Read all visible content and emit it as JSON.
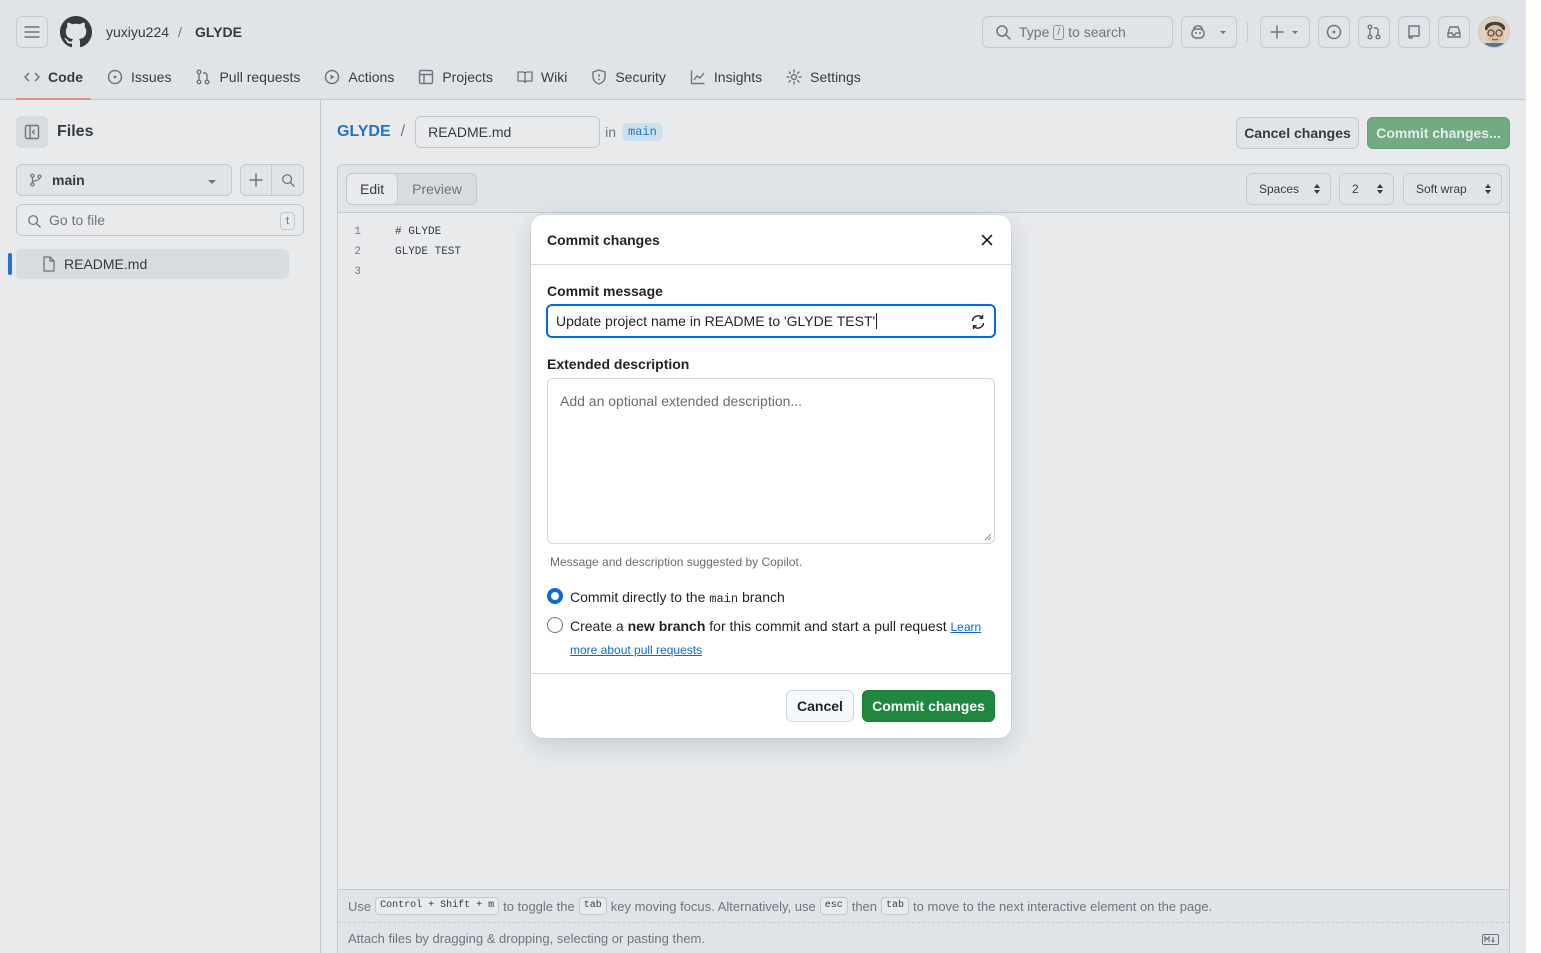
{
  "header": {
    "owner": "yuxiyu224",
    "separator": "/",
    "repo": "GLYDE",
    "search_prefix": "Type",
    "search_key": "/",
    "search_suffix": "to search"
  },
  "nav_tabs": [
    {
      "label": "Code",
      "icon": "code-icon"
    },
    {
      "label": "Issues",
      "icon": "issue-icon"
    },
    {
      "label": "Pull requests",
      "icon": "pull-request-icon"
    },
    {
      "label": "Actions",
      "icon": "play-icon"
    },
    {
      "label": "Projects",
      "icon": "table-icon"
    },
    {
      "label": "Wiki",
      "icon": "book-icon"
    },
    {
      "label": "Security",
      "icon": "shield-icon"
    },
    {
      "label": "Insights",
      "icon": "graph-icon"
    },
    {
      "label": "Settings",
      "icon": "gear-icon"
    }
  ],
  "sidebar": {
    "title": "Files",
    "branch": "main",
    "goto_placeholder": "Go to file",
    "goto_shortcut": "t",
    "files": [
      {
        "name": "README.md"
      }
    ]
  },
  "editor": {
    "repo": "GLYDE",
    "separator": "/",
    "filename": "README.md",
    "in_label": "in",
    "branch": "main",
    "cancel_label": "Cancel changes",
    "commit_label": "Commit changes...",
    "tab_edit": "Edit",
    "tab_preview": "Preview",
    "indent_mode": "Spaces",
    "indent_size": "2",
    "wrap_mode": "Soft wrap",
    "lines": [
      {
        "n": "1",
        "text": "# GLYDE"
      },
      {
        "n": "2",
        "text": "GLYDE TEST"
      },
      {
        "n": "3",
        "text": ""
      }
    ],
    "footer_hint": {
      "t1": "Use",
      "k1": "Control + Shift + m",
      "t2": "to toggle the",
      "k2": "tab",
      "t3": "key moving focus. Alternatively, use",
      "k3": "esc",
      "t4": "then",
      "k4": "tab",
      "t5": "to move to the next interactive element on the page."
    },
    "attach_hint": "Attach files by dragging & dropping, selecting or pasting them."
  },
  "dialog": {
    "title": "Commit changes",
    "message_label": "Commit message",
    "message_value": "Update project name in README to 'GLYDE TEST'",
    "description_label": "Extended description",
    "description_placeholder": "Add an optional extended description...",
    "copilot_note": "Message and description suggested by Copilot.",
    "option1": {
      "pre": "Commit directly to the",
      "branch": "main",
      "post": "branch",
      "selected": true
    },
    "option2": {
      "pre": "Create a",
      "bold": "new branch",
      "post": "for this commit and start a pull request",
      "link1": "Learn",
      "link2": "more about pull requests",
      "selected": false
    },
    "cancel_label": "Cancel",
    "commit_label": "Commit changes"
  },
  "colors": {
    "accent": "#0969da",
    "primary_button": "#1f883d",
    "disabled_primary": "#6cb17a",
    "active_tab_underline": "#fd8c73"
  }
}
